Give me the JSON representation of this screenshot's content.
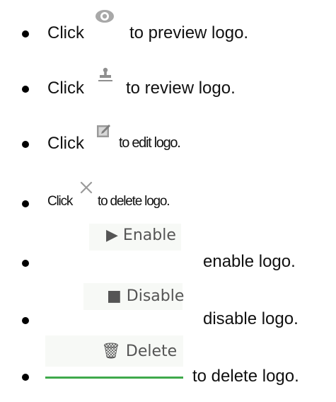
{
  "items": [
    {
      "prefix": "Click",
      "suffix": "to preview logo.",
      "icon": "eye-icon"
    },
    {
      "prefix": "Click",
      "suffix": "to review logo.",
      "icon": "stamp-icon"
    },
    {
      "prefix": "Click",
      "suffix": "to edit logo.",
      "icon": "edit-icon"
    },
    {
      "prefix": "Click",
      "suffix": "to delete logo.",
      "icon": "close-icon"
    },
    {
      "button": "▶ Enable",
      "suffix": "enable logo.",
      "icon": "play-icon"
    },
    {
      "button": "■ Disable",
      "suffix": "disable logo.",
      "icon": "stop-icon"
    },
    {
      "button": "🗑 Delete",
      "suffix": "to delete logo.",
      "icon": "trash-icon"
    }
  ],
  "colors": {
    "icon_gray": "#9a9a9a",
    "button_text": "#555555",
    "underline_green": "#3fa94b"
  }
}
